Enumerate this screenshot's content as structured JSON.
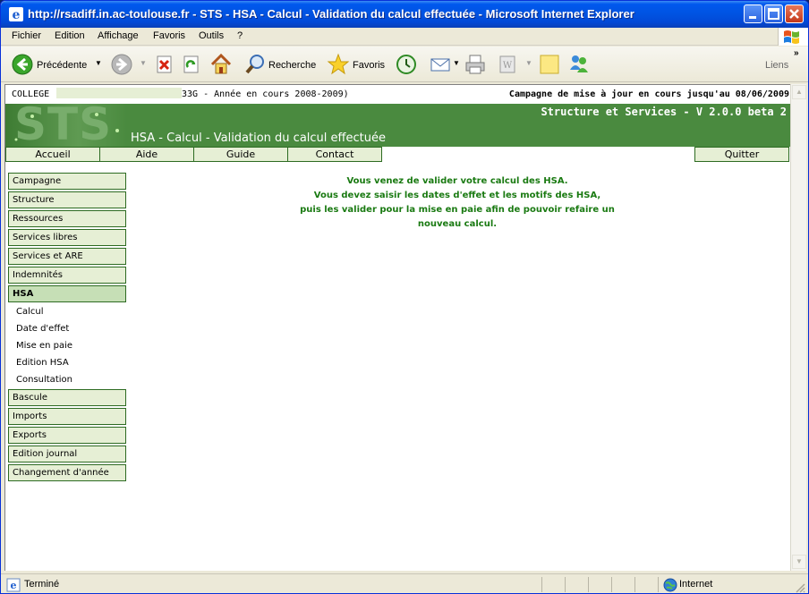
{
  "window": {
    "title": "http://rsadiff.in.ac-toulouse.fr - STS - HSA - Calcul - Validation du calcul effectuée - Microsoft Internet Explorer"
  },
  "menubar": {
    "items": [
      "Fichier",
      "Edition",
      "Affichage",
      "Favoris",
      "Outils",
      "?"
    ]
  },
  "toolbar": {
    "back_label": "Précédente",
    "search_label": "Recherche",
    "favorites_label": "Favoris",
    "links_label": "Liens",
    "links_chevron": "»"
  },
  "info_line": {
    "college_label": "COLLEGE",
    "college_suffix": "33G - Année en cours 2008-2009)",
    "campagne": "Campagne de mise à jour en cours jusqu'au 08/06/2009"
  },
  "header": {
    "logo_text": "STS",
    "version": "Structure et Services - V 2.0.0 beta 2",
    "page_title": "HSA - Calcul - Validation du calcul effectuée"
  },
  "nav": {
    "items": [
      "Accueil",
      "Aide",
      "Guide",
      "Contact"
    ],
    "quit": "Quitter"
  },
  "sidebar": {
    "items_top": [
      "Campagne",
      "Structure",
      "Ressources",
      "Services libres",
      "Services et ARE",
      "Indemnités",
      "HSA"
    ],
    "hsa_sub": [
      "Calcul",
      "Date d'effet",
      "Mise en paie",
      "Edition HSA",
      "Consultation"
    ],
    "items_bottom": [
      "Bascule",
      "Imports",
      "Exports",
      "Edition journal",
      "Changement d'année"
    ]
  },
  "message": {
    "line1": "Vous venez de valider votre calcul des HSA.",
    "line2": "Vous devez saisir les dates d'effet et les motifs des HSA,",
    "line3": "puis les valider pour la mise en paie afin de pouvoir refaire un",
    "line4": "nouveau calcul."
  },
  "status": {
    "text": "Terminé",
    "zone": "Internet"
  },
  "colors": {
    "title_blue": "#0054e3",
    "sts_green": "#4a8a3f",
    "nav_fill": "#e6efd5",
    "message_green": "#1a7a12"
  }
}
